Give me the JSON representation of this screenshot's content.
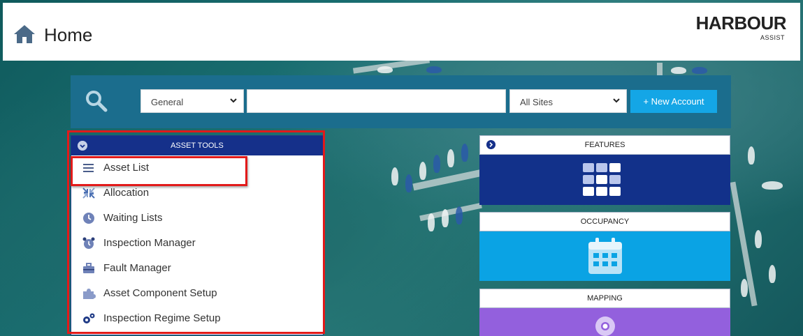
{
  "header": {
    "title": "Home",
    "logo_main": "HARBOUR",
    "logo_sub": "ASSIST"
  },
  "search": {
    "type_select": "General",
    "query_value": "",
    "site_select": "All Sites",
    "new_account_label": "+ New Account"
  },
  "asset_tools": {
    "title": "ASSET TOOLS",
    "items": [
      {
        "label": "Asset List",
        "icon": "list-icon"
      },
      {
        "label": "Allocation",
        "icon": "compress-arrows-icon"
      },
      {
        "label": "Waiting Lists",
        "icon": "clock-icon"
      },
      {
        "label": "Inspection Manager",
        "icon": "alarm-clock-icon"
      },
      {
        "label": "Fault Manager",
        "icon": "toolbox-icon"
      },
      {
        "label": "Asset Component Setup",
        "icon": "puzzle-piece-icon"
      },
      {
        "label": "Inspection Regime Setup",
        "icon": "cogs-icon"
      }
    ]
  },
  "tiles": {
    "features": {
      "title": "FEATURES",
      "icon": "grid-icon",
      "color": "#12318a"
    },
    "occupancy": {
      "title": "OCCUPANCY",
      "icon": "calendar-icon",
      "color": "#0aa3e4"
    },
    "mapping": {
      "title": "MAPPING",
      "icon": "map-marker-icon",
      "color": "#9360dd"
    }
  },
  "colors": {
    "brand_navy": "#15308a",
    "search_bar": "#1b6d8d",
    "button_blue": "#14a6e6",
    "highlight_red": "#e21a1a"
  }
}
